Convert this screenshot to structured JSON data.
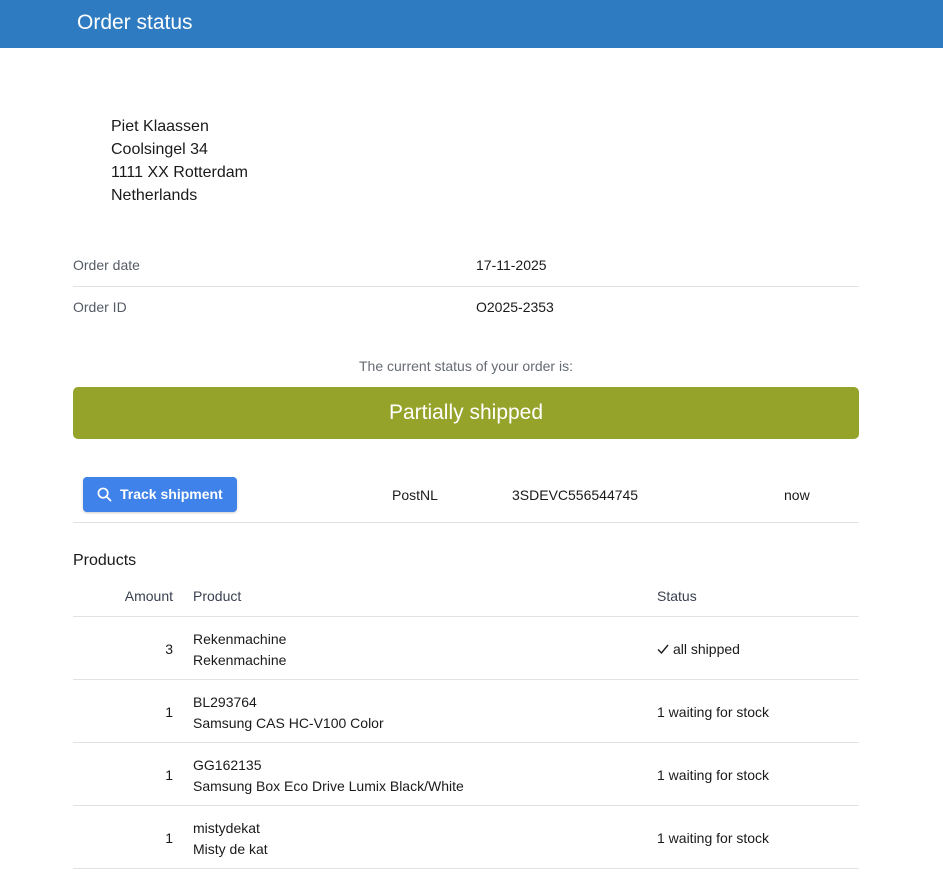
{
  "header": {
    "title": "Order status"
  },
  "address": {
    "lines": [
      "Piet Klaassen",
      "Coolsingel 34",
      "1111 XX Rotterdam",
      "Netherlands"
    ]
  },
  "order_info": {
    "rows": [
      {
        "label": "Order date",
        "value": "17-11-2025"
      },
      {
        "label": "Order ID",
        "value": "O2025-2353"
      }
    ]
  },
  "status": {
    "caption": "The current status of your order is:",
    "value": "Partially shipped",
    "color": "#96a32a"
  },
  "shipment": {
    "button_label": "Track shipment",
    "button_icon": "search-icon",
    "carrier": "PostNL",
    "tracking_code": "3SDEVC556544745",
    "time": "now"
  },
  "products": {
    "title": "Products",
    "columns": {
      "amount": "Amount",
      "product": "Product",
      "status": "Status"
    },
    "rows": [
      {
        "amount": "3",
        "code": "Rekenmachine",
        "name": "Rekenmachine",
        "status": "all shipped",
        "status_icon": "check-icon"
      },
      {
        "amount": "1",
        "code": "BL293764",
        "name": "Samsung CAS HC-V100 Color",
        "status": "1 waiting for stock"
      },
      {
        "amount": "1",
        "code": "GG162135",
        "name": "Samsung Box Eco Drive Lumix Black/White",
        "status": "1 waiting for stock"
      },
      {
        "amount": "1",
        "code": "mistydekat",
        "name": "Misty de kat",
        "status": "1 waiting for stock"
      }
    ]
  },
  "colors": {
    "header_bg": "#2f7bc2",
    "button_bg": "#3f82e9"
  }
}
